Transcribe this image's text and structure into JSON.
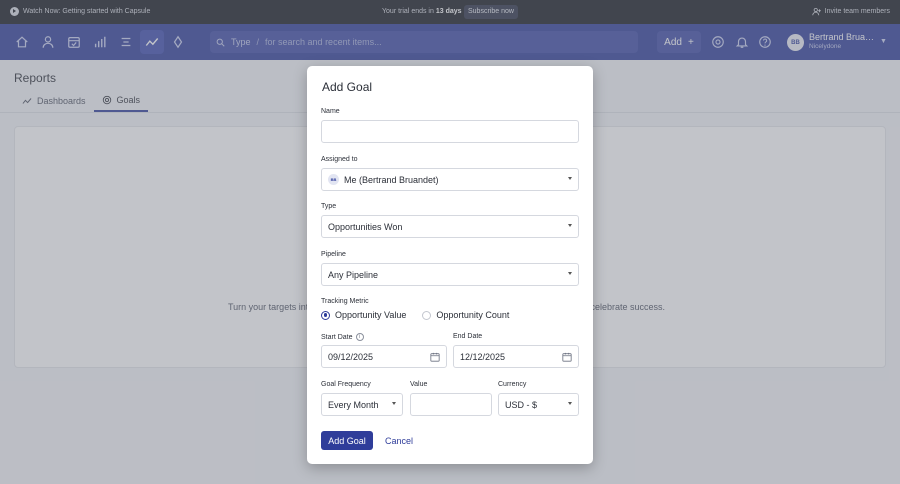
{
  "topbar": {
    "watch_text": "Watch Now: Getting started with Capsule",
    "trial_prefix": "Your trial ends in",
    "trial_days": "13 days",
    "subscribe_label": "Subscribe now",
    "invite_label": "Invite team members"
  },
  "navbar": {
    "search_type_label": "Type",
    "search_slash": "/",
    "search_placeholder": "for search and recent items...",
    "add_label": "Add",
    "add_plus": "+",
    "user_initials": "BB",
    "user_name": "Bertrand Brua…",
    "user_org": "Nicelydone"
  },
  "page": {
    "title": "Reports",
    "tabs": [
      {
        "label": "Dashboards"
      },
      {
        "label": "Goals"
      }
    ],
    "empty_text_left": "Turn your targets into",
    "empty_text_right": "d celebrate success."
  },
  "modal": {
    "title": "Add Goal",
    "name_label": "Name",
    "name_value": "",
    "assigned_label": "Assigned to",
    "assigned_initials": "BB",
    "assigned_value": "Me (Bertrand Bruandet)",
    "type_label": "Type",
    "type_value": "Opportunities Won",
    "pipeline_label": "Pipeline",
    "pipeline_value": "Any Pipeline",
    "tracking_label": "Tracking Metric",
    "tracking_options": [
      "Opportunity Value",
      "Opportunity Count"
    ],
    "tracking_selected": "Opportunity Value",
    "start_date_label": "Start Date",
    "start_date_value": "09/12/2025",
    "end_date_label": "End Date",
    "end_date_value": "12/12/2025",
    "frequency_label": "Goal Frequency",
    "frequency_value": "Every Month",
    "value_label": "Value",
    "value_value": "",
    "currency_label": "Currency",
    "currency_value": "USD - $",
    "submit_label": "Add Goal",
    "cancel_label": "Cancel"
  },
  "colors": {
    "nav_bg": "#2f3d9a",
    "topbar_bg": "#15181f",
    "primary": "#2f3d9a"
  },
  "icons": [
    "play-icon",
    "invite-icon",
    "home-icon",
    "person-icon",
    "calendar-check-icon",
    "bar-chart-icon",
    "list-icon",
    "trend-icon",
    "trophy-icon",
    "search-icon",
    "mention-icon",
    "bell-icon",
    "help-icon",
    "chevron-down-icon",
    "calendar-icon",
    "info-icon"
  ]
}
